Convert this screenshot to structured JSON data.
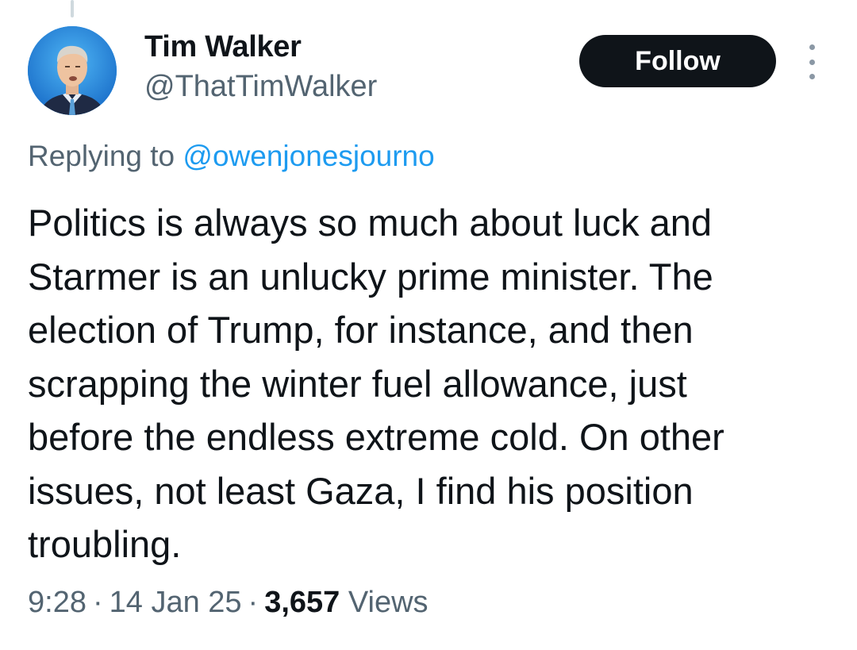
{
  "author": {
    "name": "Tim Walker",
    "handle": "@ThatTimWalker"
  },
  "follow_label": "Follow",
  "reply": {
    "prefix": "Replying to",
    "to_handle": "@owenjonesjourno"
  },
  "tweet_lines": [
    "Politics is always so much about luck and",
    "Starmer is an unlucky prime minister. The",
    "election of Trump, for instance, and then",
    "scrapping the winter fuel allowance, just",
    "before the endless extreme cold. On other",
    "issues, not least Gaza, I find his position",
    "troubling."
  ],
  "meta": {
    "time": "9:28",
    "date": "14 Jan 25",
    "views_count": "3,657",
    "views_label": "Views",
    "separator": "·"
  },
  "icons": {
    "more": "more-vertical-icon",
    "avatar": "user-avatar"
  },
  "colors": {
    "text": "#0f1419",
    "secondary": "#536471",
    "link": "#1d9bf0",
    "button_bg": "#0f1419",
    "button_text": "#ffffff"
  }
}
